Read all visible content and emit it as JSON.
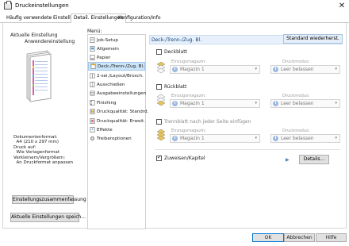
{
  "window": {
    "title": "Druckeinstellungen",
    "close_glyph": "✕"
  },
  "tabs": [
    {
      "label": "Häufig verwendete Einstellungen"
    },
    {
      "label": "Detail. Einstellungen"
    },
    {
      "label": "Konfiguration/Info"
    }
  ],
  "left": {
    "current_label": "Aktuelle Einstellung",
    "profile_name": "Anwendereinstellung",
    "doc_info_lines": [
      "Dokumentenformat:",
      "  A4 (210 x 297 mm)",
      "Druck auf:",
      "  Wie Vorlagenformat",
      "Verkleinern/Vergrößern:",
      "  An Druckformat anpassen"
    ],
    "summary_button": "Einstellungszusammenfassung",
    "save_button": "Aktuelle Einstellungen speich..."
  },
  "menu": {
    "label": "Menü:",
    "items": [
      {
        "label": "Job-Setup",
        "icon": "job-setup-icon"
      },
      {
        "label": "Allgemein",
        "icon": "general-icon"
      },
      {
        "label": "Papier",
        "icon": "paper-icon"
      },
      {
        "label": "Deck-/Trenn-/Zug. Bl.",
        "icon": "cover-sheet-icon"
      },
      {
        "label": "2-sei./Layout/Brosch.",
        "icon": "duplex-icon"
      },
      {
        "label": "Ausschießen",
        "icon": "imposition-icon"
      },
      {
        "label": "Ausgabeeinstellungen",
        "icon": "output-icon"
      },
      {
        "label": "Finishing",
        "icon": "finishing-icon"
      },
      {
        "label": "Druckqualität: Standrd.",
        "icon": "quality-standard-icon"
      },
      {
        "label": "Druckqualität: Erweit.",
        "icon": "quality-advanced-icon"
      },
      {
        "label": "Effekte",
        "icon": "effects-icon"
      },
      {
        "label": "Treiberoptionen",
        "icon": "driver-options-icon"
      }
    ],
    "selected_index": 3
  },
  "right": {
    "header_title": "Deck-/Trenn-/Zug. Bl.",
    "standard_button": "Standard wiederherst.",
    "sections": [
      {
        "checkbox_label": "Deckblatt",
        "checked": false,
        "tray_label": "Einzugsmagazin:",
        "tray_value": "Magazin 1",
        "mode_label": "Druckmodus:",
        "mode_value": "Leer belassen"
      },
      {
        "checkbox_label": "Rückblatt",
        "checked": false,
        "tray_label": "Einzugsmagazin:",
        "tray_value": "Magazin 1",
        "mode_label": "Druckmodus:",
        "mode_value": "Leer belassen"
      },
      {
        "checkbox_label": "Trennblatt nach jeder Seite einfügen",
        "checked": false,
        "tray_label": "Einzugsmagazin:",
        "tray_value": "Magazin 1",
        "mode_label": "Druckmodus:",
        "mode_value": "Leer belassen"
      }
    ],
    "chapter": {
      "checkbox_label": "Zuweisen/Kapitel",
      "checked": true,
      "details_button": "Details..."
    }
  },
  "footer": {
    "ok": "OK",
    "cancel": "Abbrechen",
    "help": "Hilfe"
  },
  "colors": {
    "accent": "#0078d7",
    "selected_bg": "#cce4f7",
    "info_icon": "#3d7bd1"
  }
}
